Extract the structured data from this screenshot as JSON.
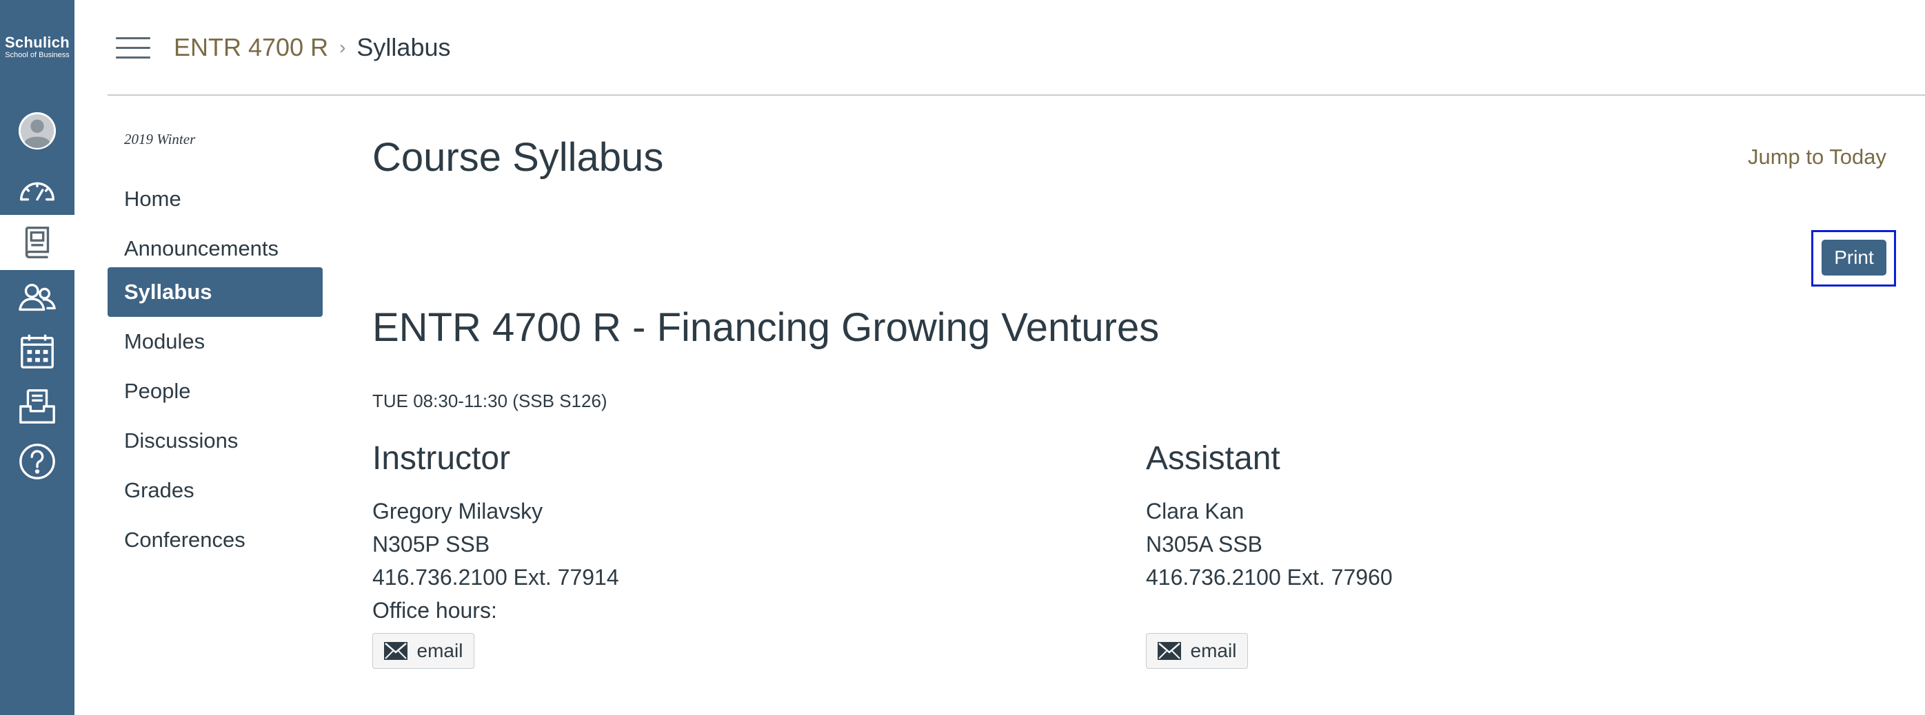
{
  "brand": {
    "name": "Schulich",
    "subtitle": "School of Business"
  },
  "global_nav": {
    "items": [
      {
        "name": "account",
        "icon": "avatar-icon"
      },
      {
        "name": "dashboard",
        "icon": "dashboard-icon"
      },
      {
        "name": "courses",
        "icon": "courses-book-icon",
        "active": true
      },
      {
        "name": "groups",
        "icon": "groups-icon"
      },
      {
        "name": "calendar",
        "icon": "calendar-icon"
      },
      {
        "name": "inbox",
        "icon": "inbox-icon"
      },
      {
        "name": "help",
        "icon": "help-icon"
      }
    ]
  },
  "breadcrumb": {
    "course": "ENTR 4700 R",
    "separator": "›",
    "current": "Syllabus"
  },
  "course_nav": {
    "term": "2019 Winter",
    "items": [
      "Home",
      "Announcements",
      "Syllabus",
      "Modules",
      "People",
      "Discussions",
      "Grades",
      "Conferences"
    ],
    "active": "Syllabus"
  },
  "main": {
    "title": "Course Syllabus",
    "jump_to_today": "Jump to Today",
    "print_label": "Print",
    "course_heading": "ENTR 4700 R - Financing Growing Ventures",
    "schedule": "TUE 08:30-11:30 (SSB S126)",
    "instructor": {
      "heading": "Instructor",
      "name": "Gregory Milavsky",
      "office": "N305P SSB",
      "phone": "416.736.2100 Ext. 77914",
      "office_hours": "Office hours:",
      "email_label": "email"
    },
    "assistant": {
      "heading": "Assistant",
      "name": "Clara Kan",
      "office": "N305A SSB",
      "phone": "416.736.2100 Ext. 77960",
      "email_label": "email"
    }
  },
  "colors": {
    "brand_blue": "#3e6486",
    "link_gold": "#7a6b47",
    "text": "#2d3b45",
    "focus_outline": "#0b1fd6"
  }
}
